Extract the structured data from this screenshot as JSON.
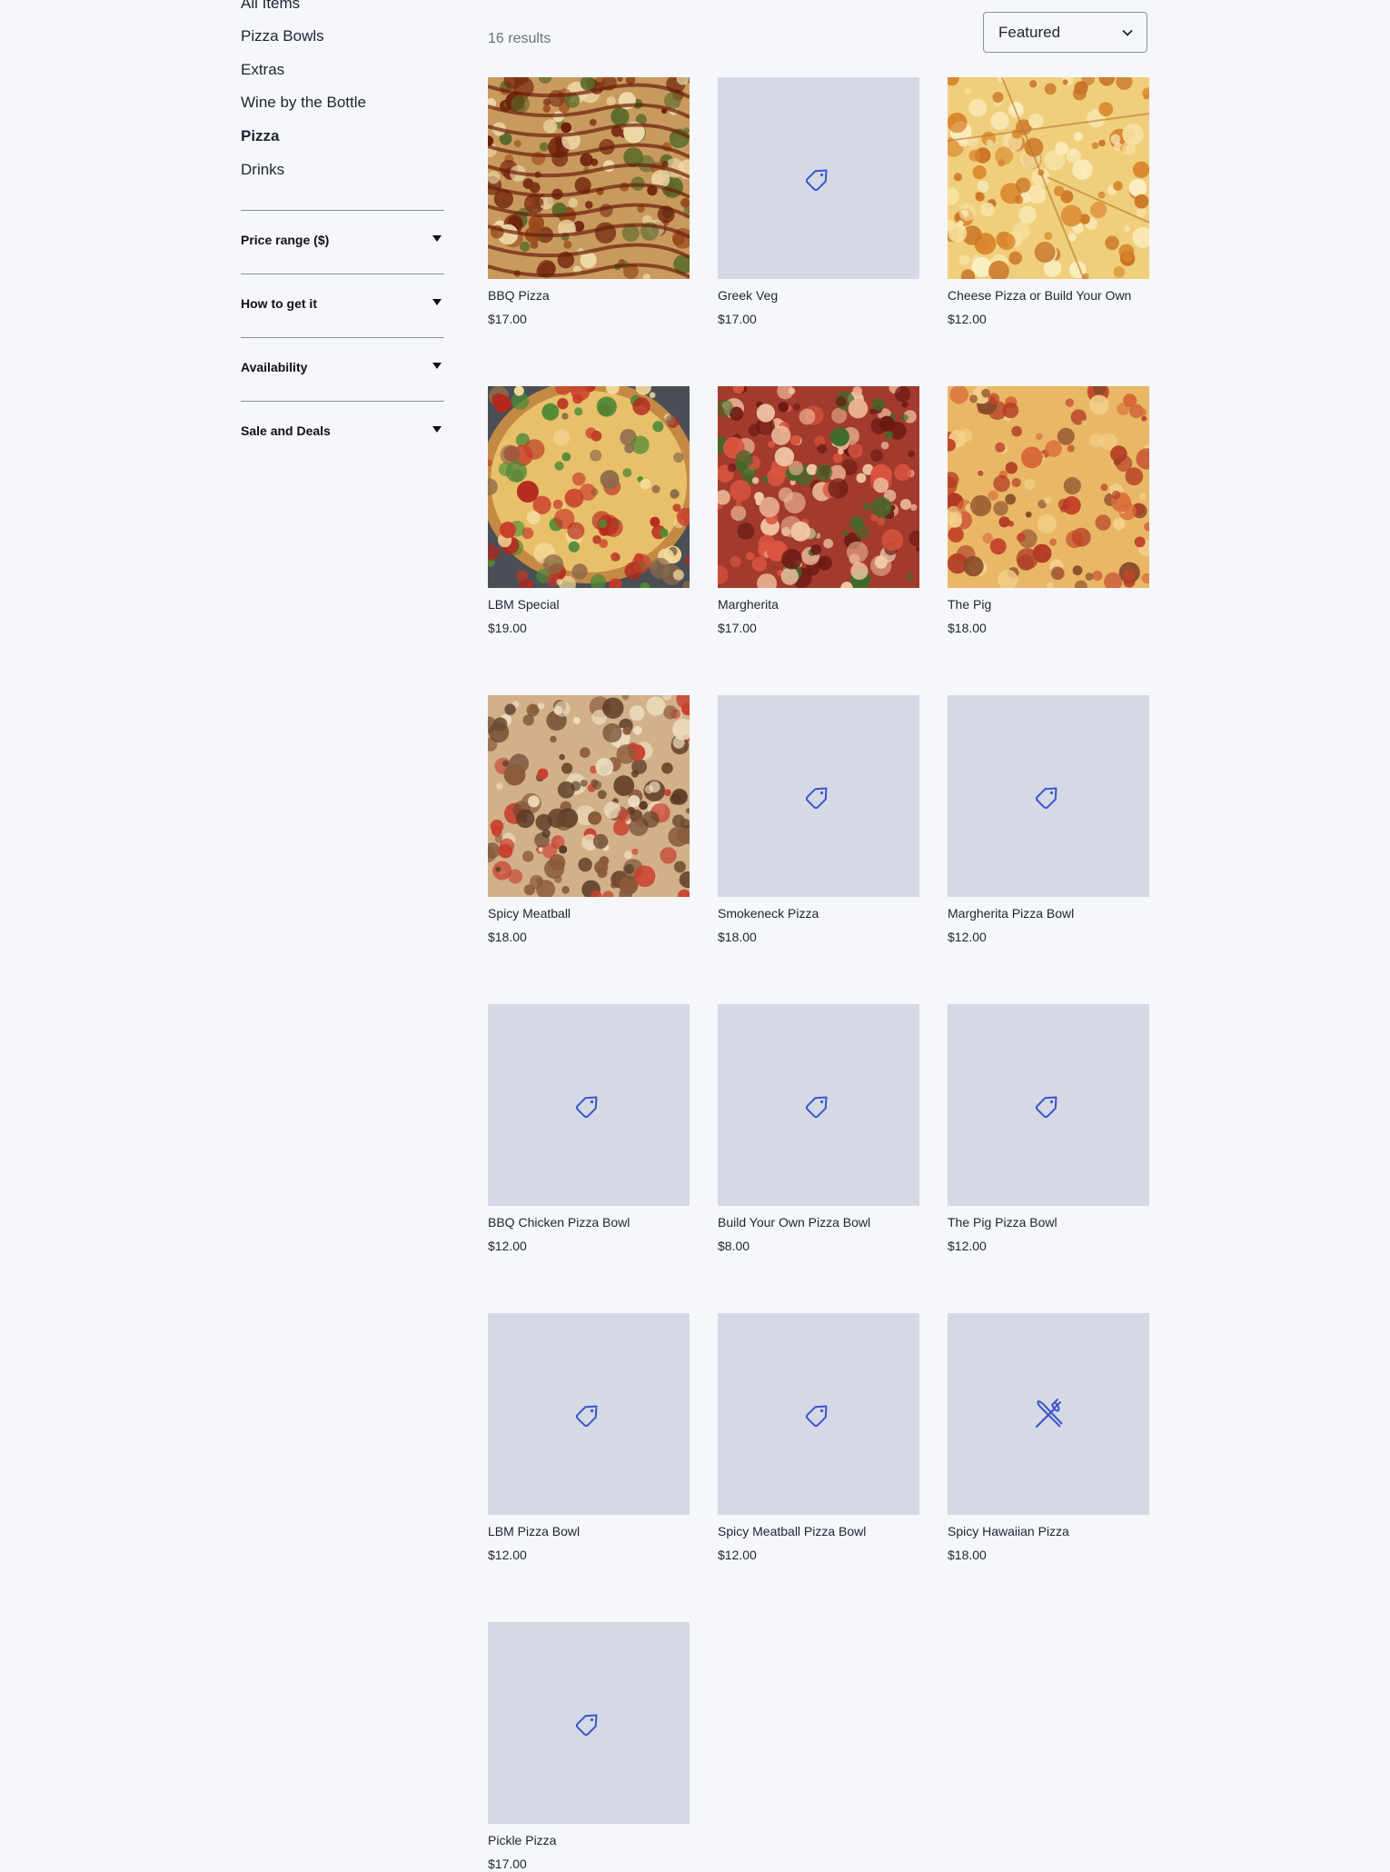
{
  "sidebar": {
    "categories": [
      {
        "label": "All Items",
        "active": false
      },
      {
        "label": "Pizza Bowls",
        "active": false
      },
      {
        "label": "Extras",
        "active": false
      },
      {
        "label": "Wine by the Bottle",
        "active": false
      },
      {
        "label": "Pizza",
        "active": true
      },
      {
        "label": "Drinks",
        "active": false
      }
    ],
    "filters": [
      {
        "label": "Price range ($)"
      },
      {
        "label": "How to get it"
      },
      {
        "label": "Availability"
      },
      {
        "label": "Sale and Deals"
      }
    ]
  },
  "toolbar": {
    "results": "16 results",
    "sort_value": "Featured"
  },
  "products": [
    {
      "name": "BBQ Pizza",
      "price": "$17.00",
      "image": "bbq-pizza-photo"
    },
    {
      "name": "Greek Veg",
      "price": "$17.00",
      "image": "tag-icon"
    },
    {
      "name": "Cheese Pizza or Build Your Own",
      "price": "$12.00",
      "image": "cheese-pizza-photo"
    },
    {
      "name": "LBM Special",
      "price": "$19.00",
      "image": "lbm-special-photo"
    },
    {
      "name": "Margherita",
      "price": "$17.00",
      "image": "margherita-photo"
    },
    {
      "name": "The Pig",
      "price": "$18.00",
      "image": "the-pig-photo"
    },
    {
      "name": "Spicy Meatball",
      "price": "$18.00",
      "image": "spicy-meatball-photo"
    },
    {
      "name": "Smokeneck Pizza",
      "price": "$18.00",
      "image": "tag-icon"
    },
    {
      "name": "Margherita Pizza Bowl",
      "price": "$12.00",
      "image": "tag-icon"
    },
    {
      "name": "BBQ Chicken Pizza Bowl",
      "price": "$12.00",
      "image": "tag-icon"
    },
    {
      "name": "Build Your Own Pizza Bowl",
      "price": "$8.00",
      "image": "tag-icon"
    },
    {
      "name": "The Pig Pizza Bowl",
      "price": "$12.00",
      "image": "tag-icon"
    },
    {
      "name": "LBM Pizza Bowl",
      "price": "$12.00",
      "image": "tag-icon"
    },
    {
      "name": "Spicy Meatball Pizza Bowl",
      "price": "$12.00",
      "image": "tag-icon"
    },
    {
      "name": "Spicy Hawaiian Pizza",
      "price": "$18.00",
      "image": "utensils-icon"
    },
    {
      "name": "Pickle Pizza",
      "price": "$17.00",
      "image": "tag-icon"
    }
  ],
  "colors": {
    "background": "#f5f7fa",
    "placeholder_bg": "#d5d9e6",
    "icon_accent": "#3b55c8",
    "text": "#1f2430"
  }
}
